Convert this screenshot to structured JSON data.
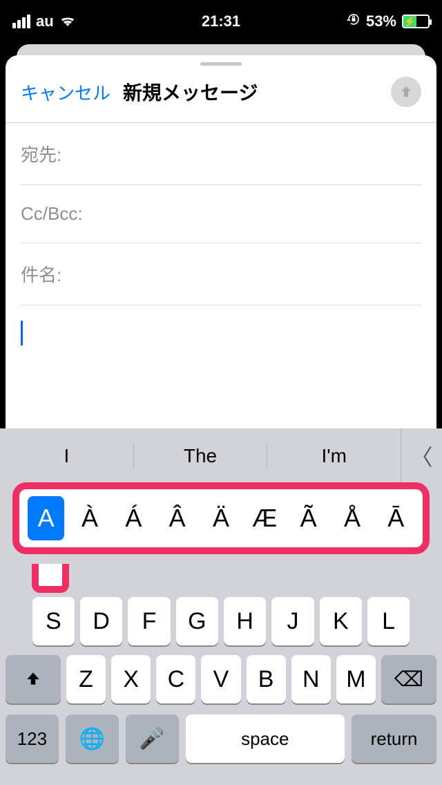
{
  "status": {
    "carrier": "au",
    "time": "21:31",
    "battery_pct": "53%"
  },
  "sheet": {
    "cancel": "キャンセル",
    "title": "新規メッセージ"
  },
  "fields": {
    "to": "宛先:",
    "ccbcc": "Cc/Bcc:",
    "subject": "件名:"
  },
  "predict": {
    "w1": "I",
    "w2": "The",
    "w3": "I'm"
  },
  "accents": {
    "sel": "A",
    "opts": [
      "À",
      "Á",
      "Â",
      "Ä",
      "Æ",
      "Ã",
      "Å",
      "Ā"
    ]
  },
  "keys": {
    "r2": [
      "S",
      "D",
      "F",
      "G",
      "H",
      "J",
      "K",
      "L"
    ],
    "r3": [
      "Z",
      "X",
      "C",
      "V",
      "B",
      "N",
      "M"
    ],
    "num": "123",
    "space": "space",
    "ret": "return"
  }
}
